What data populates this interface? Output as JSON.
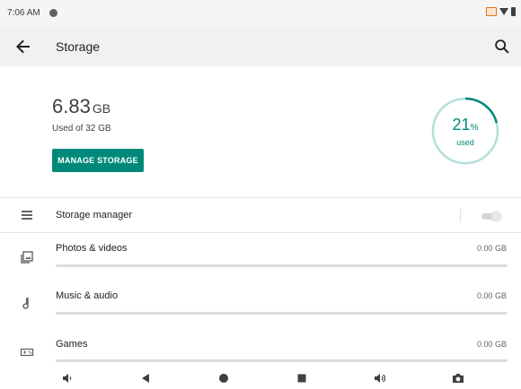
{
  "status_bar": {
    "time": "7:06 AM",
    "icons": [
      "notification-dot-icon",
      "cast-icon",
      "wifi-icon",
      "battery-icon"
    ]
  },
  "toolbar": {
    "title": "Storage",
    "back_icon": "arrow-back-icon",
    "search_icon": "search-icon"
  },
  "summary": {
    "used_value": "6.83",
    "used_unit": "GB",
    "used_of": "Used of 32 GB",
    "manage_button": "MANAGE STORAGE",
    "percent_value": "21",
    "percent_symbol": "%",
    "percent_label": "used",
    "percent_fraction": 0.21
  },
  "storage_manager": {
    "label": "Storage manager",
    "toggle_on": false
  },
  "categories": [
    {
      "label": "Photos & videos",
      "size": "0.00 GB",
      "icon": "photo-library-icon"
    },
    {
      "label": "Music & audio",
      "size": "0.00 GB",
      "icon": "music-note-icon"
    },
    {
      "label": "Games",
      "size": "0.00 GB",
      "icon": "gamepad-icon"
    }
  ],
  "nav_bar": {
    "icons": [
      "volume-down-icon",
      "back-triangle-icon",
      "home-circle-icon",
      "recents-square-icon",
      "volume-up-icon",
      "camera-icon"
    ]
  },
  "colors": {
    "accent": "#00897b",
    "ring_track": "#b2dfdb"
  }
}
